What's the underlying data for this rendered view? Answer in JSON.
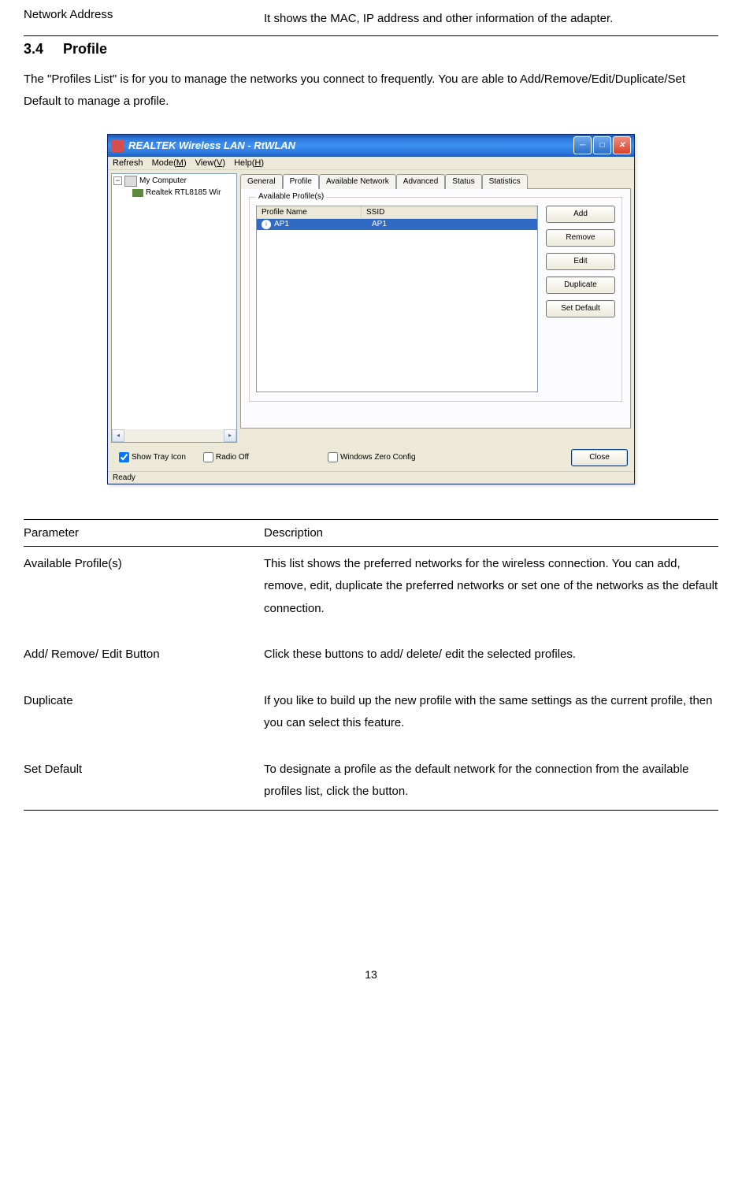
{
  "top": {
    "param": "Network Address",
    "desc": "It shows the MAC, IP address and other information of the adapter."
  },
  "heading": {
    "num": "3.4",
    "title": "Profile"
  },
  "intro": "The \"Profiles List\" is for you to manage the networks you connect to frequently. You are able to Add/Remove/Edit/Duplicate/Set Default to manage a profile.",
  "window": {
    "title": "REALTEK Wireless LAN - RtWLAN",
    "menus": {
      "refresh": "Refresh",
      "mode": "Mode(M)",
      "view": "View(V)",
      "help": "Help(H)"
    },
    "tree": {
      "node1": "My Computer",
      "node2": "Realtek RTL8185 Wir"
    },
    "tabs": {
      "general": "General",
      "profile": "Profile",
      "avail": "Available Network",
      "advanced": "Advanced",
      "status": "Status",
      "stats": "Statistics"
    },
    "group_label": "Available Profile(s)",
    "cols": {
      "pn": "Profile Name",
      "ssid": "SSID"
    },
    "row": {
      "name": "AP1",
      "ssid": "AP1"
    },
    "buttons": {
      "add": "Add",
      "remove": "Remove",
      "edit": "Edit",
      "dup": "Duplicate",
      "setdef": "Set Default"
    },
    "checks": {
      "tray": "Show Tray Icon",
      "radio": "Radio Off",
      "wz": "Windows Zero Config"
    },
    "close": "Close",
    "status_text": "Ready"
  },
  "table": {
    "head": {
      "param": "Parameter",
      "desc": "Description"
    },
    "rows": [
      {
        "param": "Available Profile(s)",
        "desc": "This list shows the preferred networks for the wireless connection. You can add, remove, edit, duplicate the preferred networks or set one of the networks as the default connection."
      },
      {
        "param": "Add/ Remove/ Edit Button",
        "desc": "Click these buttons to add/ delete/ edit the selected profiles."
      },
      {
        "param": "Duplicate",
        "desc": "If you like to build up the new profile with the same settings as the current profile, then you can select this feature."
      },
      {
        "param": "Set Default",
        "desc": "To designate a profile as the default network for the connection from the available profiles list, click the button."
      }
    ]
  },
  "page_number": "13"
}
